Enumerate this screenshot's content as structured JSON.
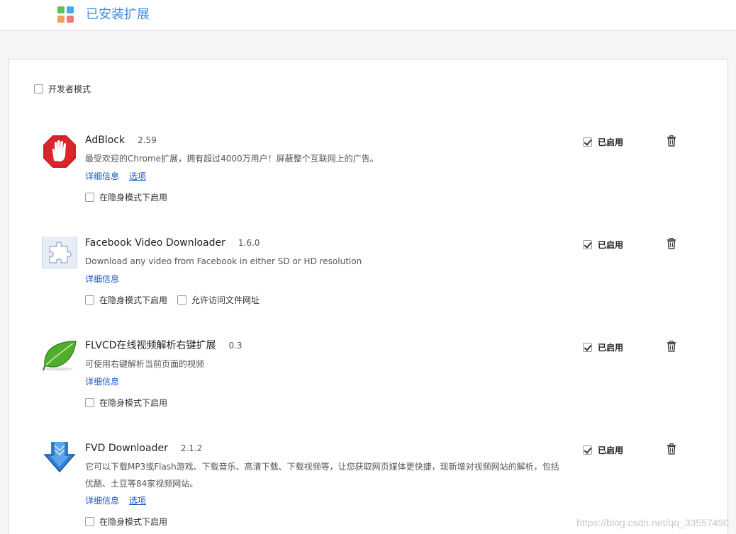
{
  "header": {
    "title": "已安装扩展"
  },
  "dev_mode": {
    "label": "开发者模式",
    "checked": false
  },
  "extensions": [
    {
      "name": "AdBlock",
      "version": "2.59",
      "description": "最受欢迎的Chrome扩展，拥有超过4000万用户！屏蔽整个互联网上的广告。",
      "links": [
        "详细信息",
        "选项"
      ],
      "options": [
        "在隐身模式下启用"
      ],
      "enabled_label": "已启用",
      "icon": "adblock-hand-icon"
    },
    {
      "name": "Facebook Video Downloader",
      "version": "1.6.0",
      "description": "Download any video from Facebook in either SD or HD resolution",
      "links": [
        "详细信息"
      ],
      "options": [
        "在隐身模式下启用",
        "允许访问文件网址"
      ],
      "enabled_label": "已启用",
      "icon": "puzzle-piece-icon"
    },
    {
      "name": "FLVCD在线视频解析右键扩展",
      "version": "0.3",
      "description": "可使用右键解析当前页面的视频",
      "links": [
        "详细信息"
      ],
      "options": [
        "在隐身模式下启用"
      ],
      "enabled_label": "已启用",
      "icon": "green-leaf-icon"
    },
    {
      "name": "FVD Downloader",
      "version": "2.1.2",
      "description": "它可以下载MP3或Flash游戏、下载音乐、高清下载、下载视频等，让您获取网页媒体更快捷，现新增对视频网站的解析，包括优酷、土豆等84家视频网站。",
      "links": [
        "详细信息",
        "选项"
      ],
      "options": [
        "在隐身模式下启用"
      ],
      "enabled_label": "已启用",
      "icon": "download-arrow-icon"
    }
  ],
  "watermark": "https://blog.csdn.net/qq_33557490",
  "colors": {
    "accent": "#3d8fe0",
    "link": "#1a55c8"
  }
}
